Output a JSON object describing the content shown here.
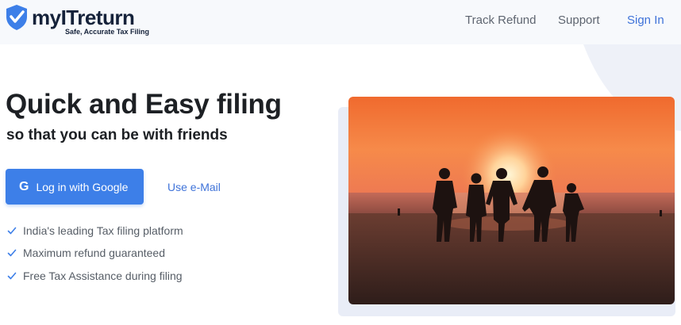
{
  "brand": {
    "name": "myITreturn",
    "tagline": "Safe, Accurate Tax Filing"
  },
  "nav": {
    "track_refund": "Track Refund",
    "support": "Support",
    "sign_in": "Sign In"
  },
  "hero": {
    "title": "Quick and Easy filing",
    "subtitle": "so that you can be with friends",
    "google_button": "Log in with Google",
    "google_glyph": "G",
    "email_link": "Use e-Mail"
  },
  "features": [
    "India's leading Tax filing platform",
    "Maximum refund guaranteed",
    "Free Tax Assistance during filing"
  ],
  "colors": {
    "accent": "#3d7fe8",
    "link": "#3f73d9",
    "brand_dark": "#15223a"
  },
  "icons": {
    "logo": "shield-check-icon",
    "google": "google-g-icon",
    "feature": "check-icon"
  }
}
